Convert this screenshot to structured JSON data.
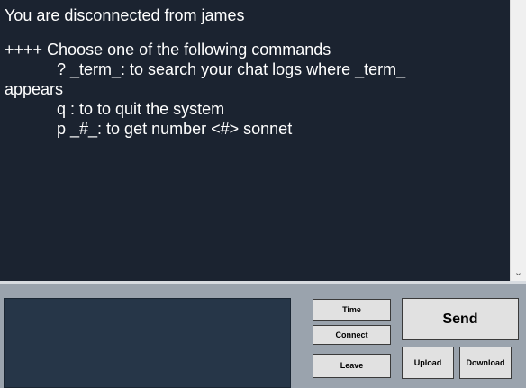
{
  "chat": {
    "lines": [
      "You are disconnected from james",
      "++++ Choose one of the following commands",
      "? _term_: to search your chat logs where _term_",
      "appears",
      "q : to to quit the system",
      "p _#_: to get number <#> sonnet"
    ]
  },
  "scrollbar": {
    "down_arrow_icon": "chevron-down-icon"
  },
  "input": {
    "value": ""
  },
  "buttons": {
    "time": "Time",
    "connect": "Connect",
    "leave": "Leave",
    "send": "Send",
    "upload": "Upload",
    "download": "Download"
  },
  "colors": {
    "chat_background": "#1b2330",
    "chat_text": "#ffffff",
    "panel_background": "#9aa3ad",
    "input_background": "#263648",
    "button_background": "#e1e1e1"
  }
}
